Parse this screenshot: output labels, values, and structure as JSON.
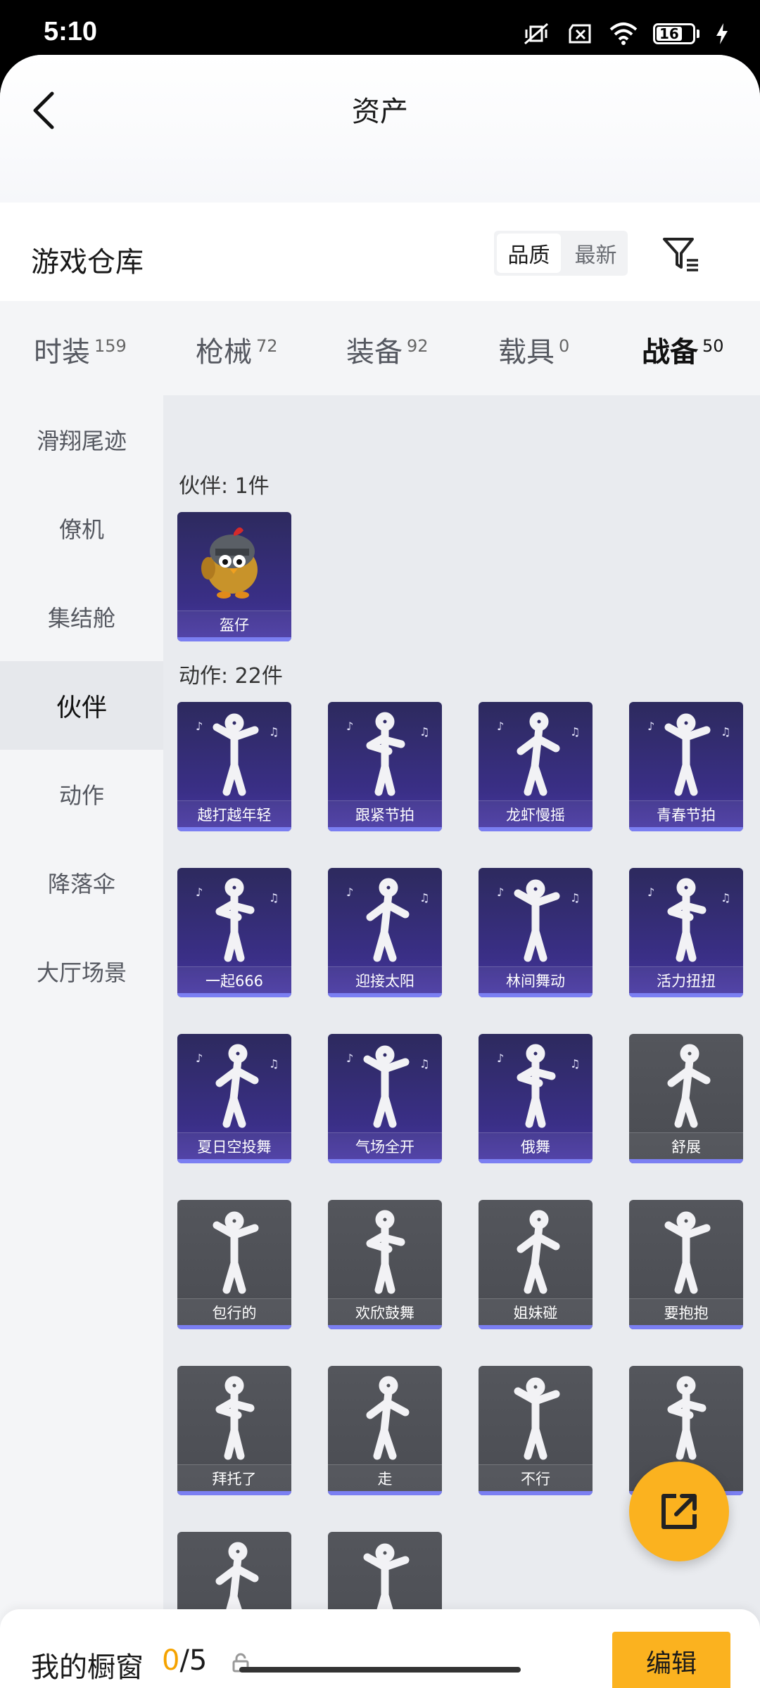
{
  "status_bar": {
    "time": "5:10",
    "battery": "16"
  },
  "navbar": {
    "title": "资产"
  },
  "section": {
    "title": "游戏仓库",
    "sort_quality": "品质",
    "sort_newest": "最新"
  },
  "tabs": [
    {
      "label": "时装",
      "count": "159"
    },
    {
      "label": "枪械",
      "count": "72"
    },
    {
      "label": "装备",
      "count": "92"
    },
    {
      "label": "载具",
      "count": "0"
    },
    {
      "label": "战备",
      "count": "50"
    }
  ],
  "sidebar": [
    "滑翔尾迹",
    "僚机",
    "集结舱",
    "伙伴",
    "动作",
    "降落伞",
    "大厅场景"
  ],
  "groups": {
    "companion": {
      "label": "伙伴: 1件",
      "items": [
        "盔仔"
      ]
    },
    "action": {
      "label": "动作: 22件",
      "items": [
        "越打越年轻",
        "跟紧节拍",
        "龙虾慢摇",
        "青春节拍",
        "一起666",
        "迎接太阳",
        "林间舞动",
        "活力扭扭",
        "夏日空投舞",
        "气场全开",
        "俄舞",
        "舒展",
        "包行的",
        "欢欣鼓舞",
        "姐妹碰",
        "要抱抱",
        "拜托了",
        "走",
        "不行",
        "",
        "",
        ""
      ]
    }
  },
  "bottom": {
    "showcase_label": "我的橱窗",
    "count_current": "0",
    "count_total": "/5",
    "edit": "编辑"
  },
  "colors": {
    "accent": "#fbb21f",
    "tab_indicator": "#f5a300",
    "purple_card": "#3a2f87",
    "gray_card": "#4f5157"
  }
}
